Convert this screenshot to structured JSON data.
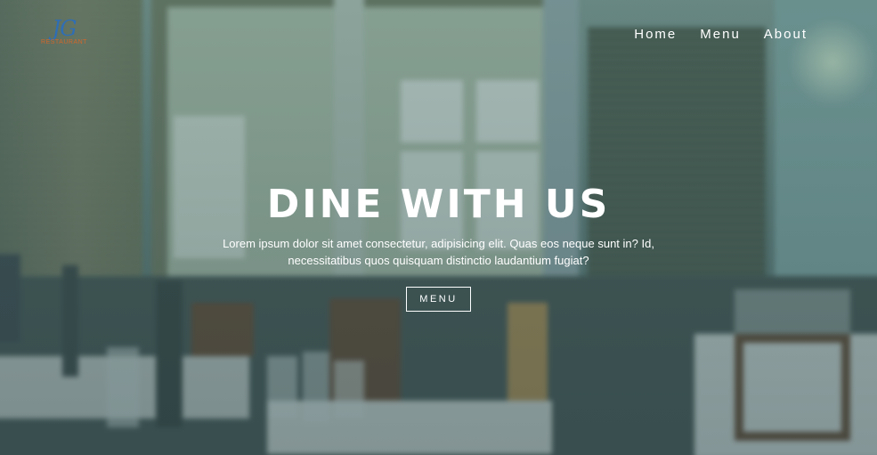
{
  "logo": {
    "mark": "JG",
    "sub": "RESTAURANT"
  },
  "nav": {
    "items": [
      "Home",
      "Menu",
      "About"
    ]
  },
  "hero": {
    "headline": "DINE WITH US",
    "tagline": "Lorem ipsum dolor sit amet consectetur, adipisicing elit. Quas eos neque sunt in? Id, necessitatibus quos quisquam distinctio laudantium fugiat?",
    "button_label": "MENU"
  },
  "colors": {
    "logo_mark": "#2e6eb6",
    "logo_sub": "#d3672a",
    "overlay": "#28505a",
    "text": "#ffffff"
  }
}
